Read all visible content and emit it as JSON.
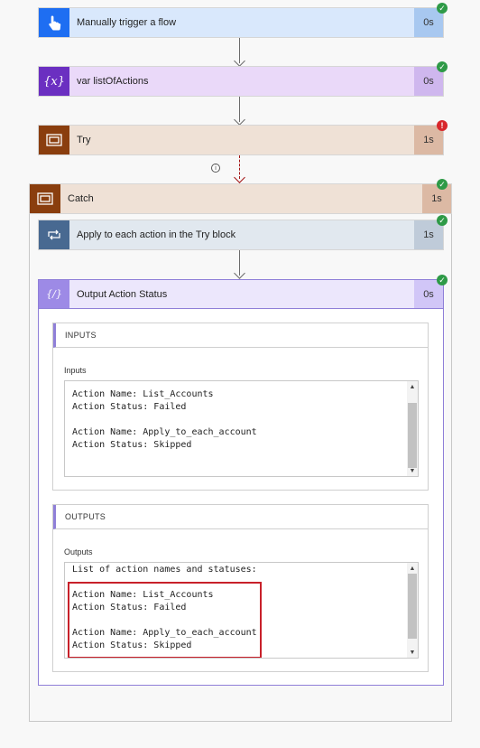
{
  "colors": {
    "trigger_icon_bg": "#1e6ef2",
    "trigger_card_bg": "#d9e8fc",
    "trigger_dur_bg": "#a8c8f0",
    "variable_icon_bg": "#6b2fc1",
    "variable_card_bg": "#ead9f9",
    "variable_dur_bg": "#cfb7ee",
    "scope_icon_bg": "#8a3e0e",
    "scope_card_bg": "#efe1d6",
    "scope_dur_bg": "#dcb9a4",
    "foreach_icon_bg": "#486991",
    "foreach_card_bg": "#e1e8ef",
    "foreach_dur_bg": "#bfcbd9",
    "compose_icon_bg": "#9d8ae6",
    "compose_card_bg": "#ece7fc",
    "compose_dur_bg": "#d1c6f7",
    "success": "#2e9a47",
    "error": "#d8272c",
    "highlight": "#c8202a"
  },
  "flow": {
    "trigger": {
      "title": "Manually trigger a flow",
      "duration": "0s",
      "icon": "hand-pointer-icon",
      "status": "succeeded"
    },
    "variable": {
      "title": "var listOfActions",
      "duration": "0s",
      "icon": "variable-icon",
      "icon_glyph": "{x}",
      "status": "succeeded"
    },
    "try": {
      "title": "Try",
      "duration": "1s",
      "icon": "scope-icon",
      "status": "failed"
    },
    "info_icon": "info-icon",
    "catch": {
      "title": "Catch",
      "duration": "1s",
      "icon": "scope-icon",
      "status": "succeeded"
    },
    "apply_each": {
      "title": "Apply to each action in the Try block",
      "duration": "1s",
      "icon": "loop-icon",
      "status": "succeeded"
    },
    "output_action": {
      "title": "Output Action Status",
      "duration": "0s",
      "icon": "compose-icon",
      "status": "succeeded",
      "inputs": {
        "header": "INPUTS",
        "label": "Inputs",
        "lines": [
          "Action Name: List_Accounts",
          "Action Status: Failed",
          "",
          "Action Name: Apply_to_each_account",
          "Action Status: Skipped"
        ]
      },
      "outputs": {
        "header": "OUTPUTS",
        "label": "Outputs",
        "lines": [
          "List of action names and statuses:",
          "",
          "Action Name: List_Accounts",
          "Action Status: Failed",
          "",
          "Action Name: Apply_to_each_account",
          "Action Status: Skipped"
        ]
      }
    }
  }
}
